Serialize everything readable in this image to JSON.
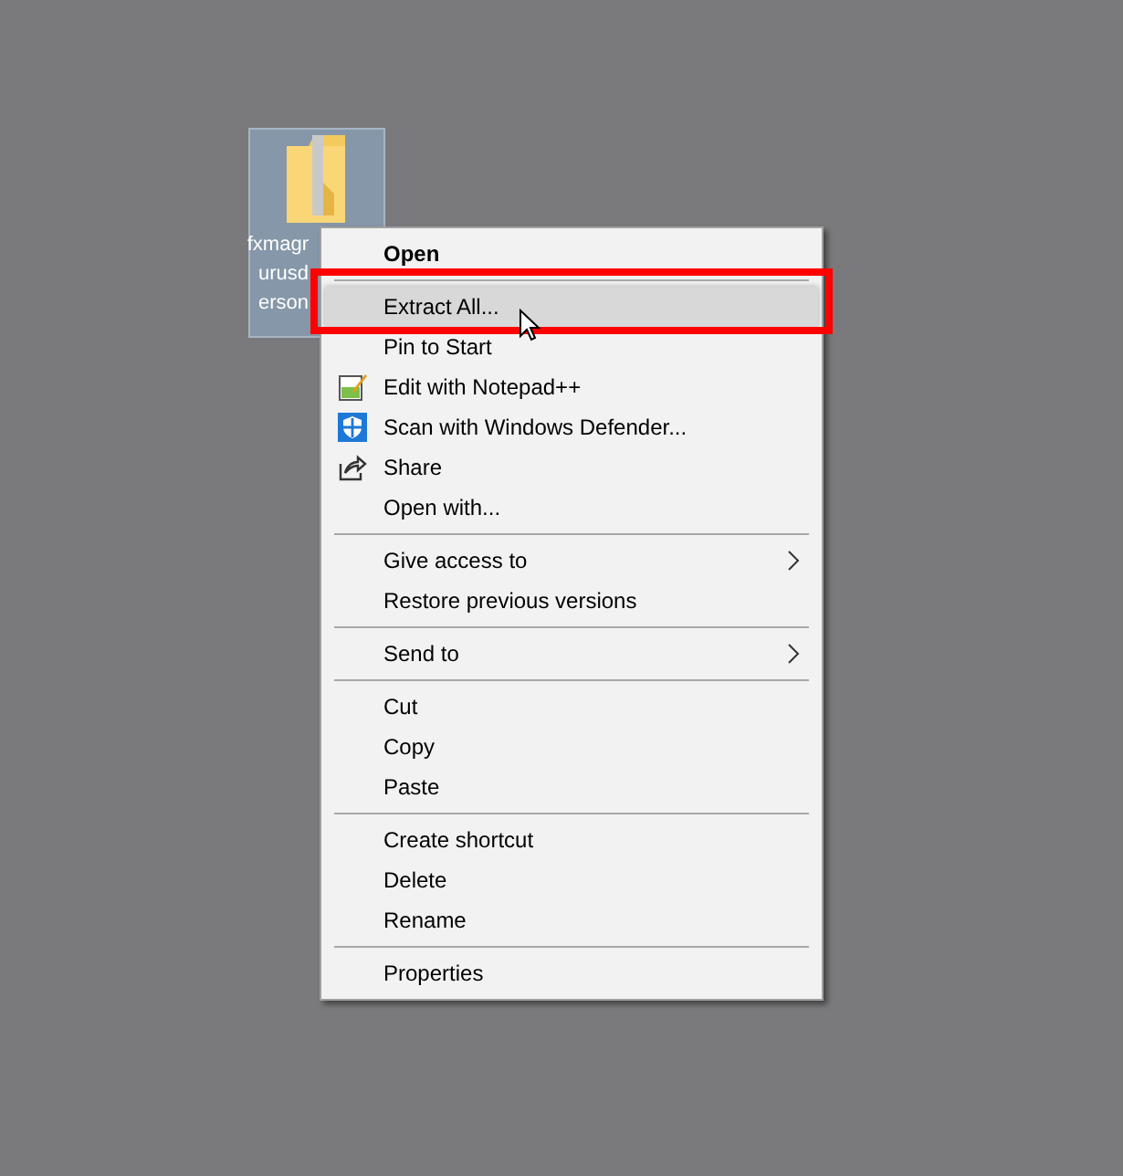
{
  "desktop_icon": {
    "label_lines": [
      "fxmagr",
      "urusd",
      "erson"
    ],
    "selected": true
  },
  "context_menu": {
    "groups": [
      {
        "items": [
          {
            "label": "Open",
            "default": true,
            "selected": false,
            "submenu": false
          }
        ]
      },
      {
        "items": [
          {
            "label": "Extract All...",
            "default": false,
            "selected": true,
            "submenu": false
          },
          {
            "label": "Pin to Start",
            "default": false,
            "selected": false,
            "submenu": false
          },
          {
            "label": "Edit with Notepad++",
            "default": false,
            "selected": false,
            "submenu": false
          },
          {
            "label": "Scan with Windows Defender...",
            "default": false,
            "selected": false,
            "submenu": false
          },
          {
            "label": "Share",
            "default": false,
            "selected": false,
            "submenu": false
          },
          {
            "label": "Open with...",
            "default": false,
            "selected": false,
            "submenu": false
          }
        ]
      },
      {
        "items": [
          {
            "label": "Give access to",
            "default": false,
            "selected": false,
            "submenu": true
          },
          {
            "label": "Restore previous versions",
            "default": false,
            "selected": false,
            "submenu": false
          }
        ]
      },
      {
        "items": [
          {
            "label": "Send to",
            "default": false,
            "selected": false,
            "submenu": true
          }
        ]
      },
      {
        "items": [
          {
            "label": "Cut",
            "default": false,
            "selected": false,
            "submenu": false
          },
          {
            "label": "Copy",
            "default": false,
            "selected": false,
            "submenu": false
          },
          {
            "label": "Paste",
            "default": false,
            "selected": false,
            "submenu": false
          }
        ]
      },
      {
        "items": [
          {
            "label": "Create shortcut",
            "default": false,
            "selected": false,
            "submenu": false
          },
          {
            "label": "Delete",
            "default": false,
            "selected": false,
            "submenu": false
          },
          {
            "label": "Rename",
            "default": false,
            "selected": false,
            "submenu": false
          }
        ]
      },
      {
        "items": [
          {
            "label": "Properties",
            "default": false,
            "selected": false,
            "submenu": false
          }
        ]
      }
    ]
  }
}
